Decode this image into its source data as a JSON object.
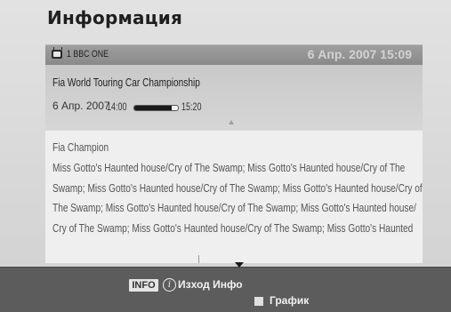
{
  "header": {
    "title": "Информация"
  },
  "channel": {
    "icon": "tv-icon",
    "name": "1 BBC ONE",
    "datetime": "6 Апр. 2007 15:09"
  },
  "program": {
    "title": "Fia World Touring Car Championship",
    "date": "6 Апр. 2007",
    "start_time": "14:00",
    "end_time": "15:20",
    "progress_fraction": 0.85
  },
  "description": {
    "lines": [
      "Fia Champion",
      "Miss Gotto's Haunted house/Cry of The Swamp; Miss Gotto's Haunted house/Cry of The",
      "Swamp; Miss Gotto's Haunted house/Cry of The Swamp; Miss Gotto's Haunted house/Cry of",
      "The Swamp; Miss Gotto's Haunted house/Cry of The Swamp; Miss Gotto's Haunted house/",
      "Cry of The Swamp; Miss Gotto's Haunted house/Cry of The Swamp; Miss Gotto's Haunted"
    ]
  },
  "footer": {
    "info_key": "INFO",
    "info_icon": "info-circle-icon",
    "exit_label": "Изход Инфо",
    "schedule_label": "График"
  },
  "colors": {
    "panel": "#d8d8d8",
    "channel_bar": "#969696",
    "description_bg": "#efefef",
    "footer": "#5c5c5c"
  }
}
